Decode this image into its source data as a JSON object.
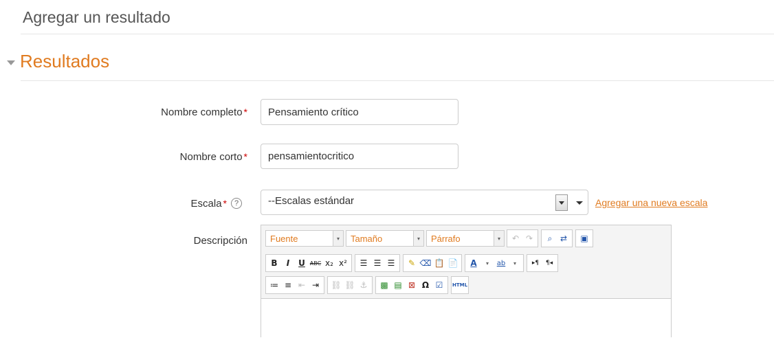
{
  "page": {
    "heading": "Agregar un resultado"
  },
  "section": {
    "title": "Resultados"
  },
  "form": {
    "full_name": {
      "label": "Nombre completo",
      "required_mark": "*",
      "value": "Pensamiento crítico"
    },
    "short_name": {
      "label": "Nombre corto",
      "required_mark": "*",
      "value": "pensamientocritico"
    },
    "scale": {
      "label": "Escala",
      "required_mark": "*",
      "help_glyph": "?",
      "selected": "--Escalas estándar",
      "add_link": "Agregar una nueva escala"
    },
    "description": {
      "label": "Descripción"
    }
  },
  "editor": {
    "font_label": "Fuente",
    "size_label": "Tamaño",
    "format_label": "Párrafo"
  },
  "colors": {
    "accent": "#e07b20",
    "required": "#cc0000",
    "border": "#cccccc"
  }
}
